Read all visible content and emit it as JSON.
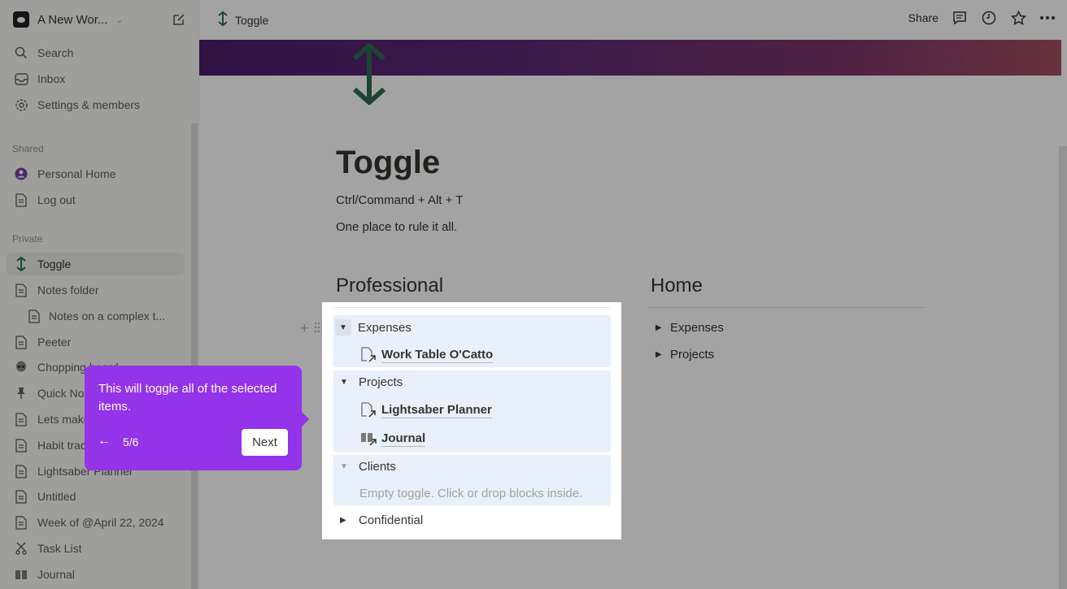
{
  "workspace": {
    "name": "A New Wor..."
  },
  "sidebar": {
    "top": [
      {
        "label": "Search",
        "icon": "search-icon"
      },
      {
        "label": "Inbox",
        "icon": "inbox-icon"
      },
      {
        "label": "Settings & members",
        "icon": "gear-icon"
      }
    ],
    "shared_label": "Shared",
    "shared": [
      {
        "label": "Personal Home",
        "icon": "person-icon"
      },
      {
        "label": "Log out",
        "icon": "page-icon"
      }
    ],
    "private_label": "Private",
    "private": [
      {
        "label": "Toggle",
        "icon": "toggle-arrows-icon"
      },
      {
        "label": "Notes folder",
        "icon": "page-icon"
      },
      {
        "label": "Notes on a complex t...",
        "icon": "page-icon"
      },
      {
        "label": "Peeter",
        "icon": "page-icon"
      },
      {
        "label": "Chopping board",
        "icon": "alien-icon"
      },
      {
        "label": "Quick Notes",
        "icon": "pin-icon"
      },
      {
        "label": "Lets make",
        "icon": "page-icon"
      },
      {
        "label": "Habit tracker",
        "icon": "page-icon"
      },
      {
        "label": "Lightsaber Planner",
        "icon": "page-icon"
      },
      {
        "label": "Untitled",
        "icon": "page-icon"
      },
      {
        "label": "Week of @April 22, 2024",
        "icon": "page-icon"
      },
      {
        "label": "Task List",
        "icon": "scissors-icon"
      },
      {
        "label": "Journal",
        "icon": "book-icon"
      }
    ]
  },
  "topbar": {
    "breadcrumb": "Toggle",
    "share": "Share"
  },
  "page": {
    "title": "Toggle",
    "shortcut": "Ctrl/Command + Alt + T",
    "tagline": "One place to rule it all.",
    "professional": {
      "heading": "Professional",
      "expenses": "Expenses",
      "expenses_child": "Work Table O'Catto",
      "projects": "Projects",
      "projects_child_1": "Lightsaber Planner",
      "projects_child_2": "Journal",
      "clients": "Clients",
      "clients_empty": "Empty toggle. Click or drop blocks inside.",
      "confidential": "Confidential"
    },
    "home": {
      "heading": "Home",
      "expenses": "Expenses",
      "projects": "Projects"
    }
  },
  "tooltip": {
    "text": "This will toggle all of the selected items.",
    "back": "←",
    "step": "5/6",
    "next": "Next"
  },
  "colors": {
    "accent_purple": "#9333ea",
    "toggle_icon_green": "#2e6b4f",
    "selection_blue": "#e7f0fb"
  }
}
